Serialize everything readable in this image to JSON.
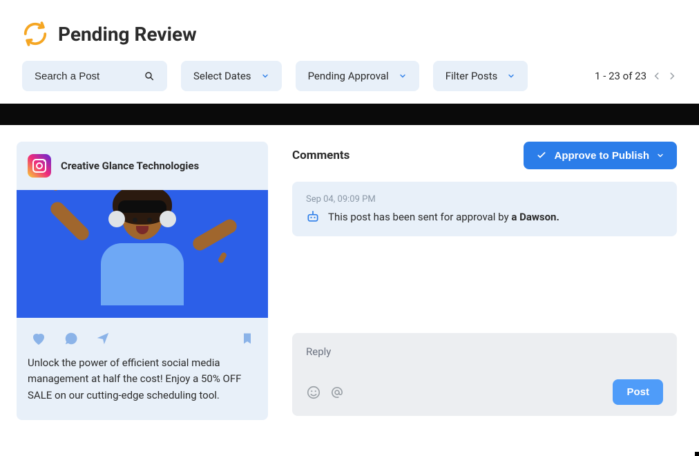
{
  "header": {
    "title": "Pending Review"
  },
  "filters": {
    "search_placeholder": "Search a Post",
    "dates_label": "Select Dates",
    "status_label": "Pending Approval",
    "filter_label": "Filter Posts"
  },
  "pager": {
    "range_text": "1 - 23 of 23"
  },
  "post": {
    "account": "Creative Glance Technologies",
    "caption": "Unlock the power of efficient social media management at half the cost!  Enjoy a 50% OFF SALE on our cutting-edge scheduling tool."
  },
  "comments": {
    "heading": "Comments",
    "approve_label": "Approve to Publish",
    "system_event": {
      "timestamp": "Sep 04, 09:09 PM",
      "text_prefix": "This post has been sent for approval by ",
      "actor": "a Dawson."
    },
    "reply": {
      "placeholder": "Reply",
      "post_label": "Post"
    }
  }
}
